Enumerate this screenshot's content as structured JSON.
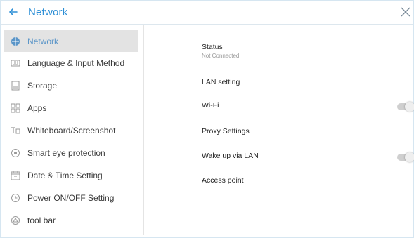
{
  "header": {
    "title": "Network"
  },
  "sidebar": {
    "items": [
      {
        "label": "Network",
        "icon": "network-icon"
      },
      {
        "label": "Language & Input Method",
        "icon": "keyboard-icon"
      },
      {
        "label": "Storage",
        "icon": "storage-icon"
      },
      {
        "label": "Apps",
        "icon": "apps-icon"
      },
      {
        "label": "Whiteboard/Screenshot",
        "icon": "whiteboard-icon"
      },
      {
        "label": "Smart eye protection",
        "icon": "eye-icon"
      },
      {
        "label": "Date & Time Setting",
        "icon": "calendar-icon"
      },
      {
        "label": "Power ON/OFF Setting",
        "icon": "power-icon"
      },
      {
        "label": "tool bar",
        "icon": "toolbar-icon"
      }
    ]
  },
  "settings": {
    "status": {
      "label": "Status",
      "value": "Not Connected"
    },
    "lan": {
      "label": "LAN setting"
    },
    "wifi": {
      "label": "Wi-Fi",
      "enabled": false
    },
    "proxy": {
      "label": "Proxy Settings"
    },
    "wol": {
      "label": "Wake up via LAN",
      "enabled": false
    },
    "ap": {
      "label": "Access point"
    }
  },
  "colors": {
    "accent": "#2d8fd6",
    "selected_bg": "#e3e3e3",
    "toggle_off": "#cfcfcf"
  }
}
